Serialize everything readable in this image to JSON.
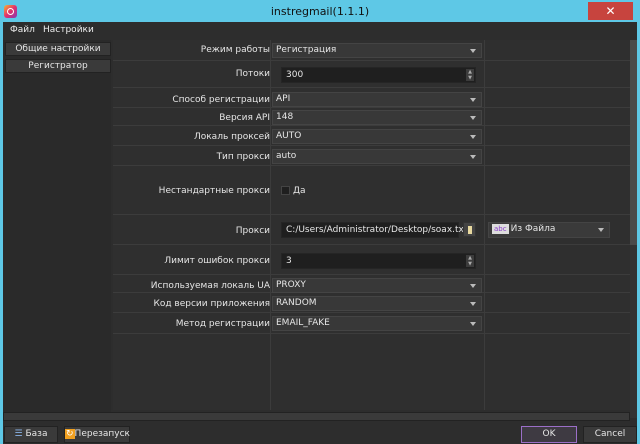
{
  "window": {
    "title": "instregmail(1.1.1)",
    "close": "✕"
  },
  "menu": [
    "Файл",
    "Настройки"
  ],
  "nav": [
    "Общие настройки",
    "Регистратор"
  ],
  "form": {
    "mode": {
      "label": "Режим работы",
      "value": "Регистрация"
    },
    "threads": {
      "label": "Потоки",
      "value": "300"
    },
    "reg_method": {
      "label": "Способ регистрации",
      "value": "API"
    },
    "api_version": {
      "label": "Версия API",
      "value": "148"
    },
    "proxy_locale": {
      "label": "Локаль проксей",
      "value": "AUTO"
    },
    "proxy_type": {
      "label": "Тип прокси",
      "value": "auto"
    },
    "custom_proxy": {
      "label": "Нестандартные прокси",
      "checkbox_label": "Да",
      "checked": false
    },
    "proxy": {
      "label": "Прокси",
      "value": "C:/Users/Administrator/Desktop/soax.txt",
      "source": "Из Файла",
      "source_icon": "abc"
    },
    "error_limit": {
      "label": "Лимит ошибок прокси",
      "value": "3"
    },
    "ua_locale": {
      "label": "Используемая локаль UA",
      "value": "PROXY"
    },
    "app_version": {
      "label": "Код версии приложения",
      "value": "RANDOM"
    },
    "registration": {
      "label": "Метод регистрации",
      "value": "EMAIL_FAKE"
    }
  },
  "buttons": {
    "db": "База",
    "restart": "Перезапуск",
    "ok": "OK",
    "cancel": "Cancel"
  }
}
